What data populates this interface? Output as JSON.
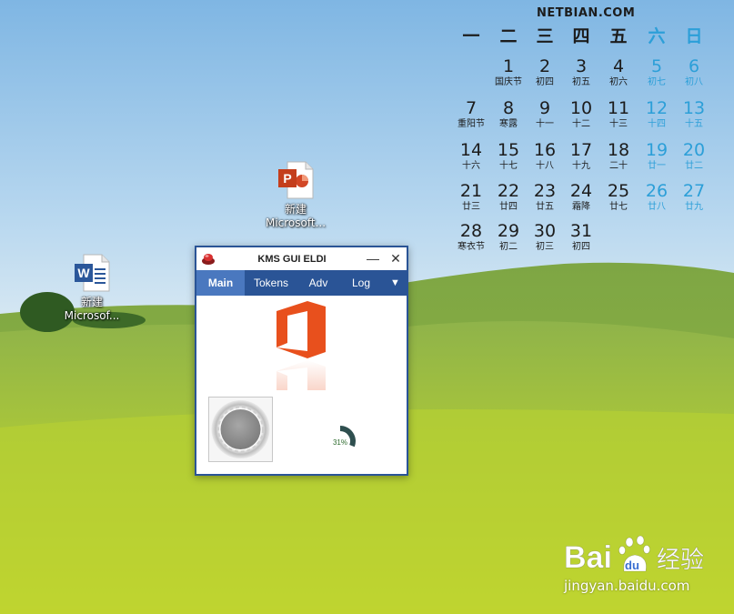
{
  "colors": {
    "window_accent": "#2a5496",
    "active_tab": "#4a78bf",
    "weekend": "#2c9fd8",
    "office_orange": "#e8501d",
    "progress_arc": "#2f4f4f"
  },
  "calendar": {
    "site": "NETBIAN.COM",
    "weekdays": [
      "一",
      "二",
      "三",
      "四",
      "五",
      "六",
      "日"
    ],
    "rows": [
      [
        null,
        null,
        null,
        null,
        null,
        null,
        null
      ],
      [
        null,
        {
          "d": "1",
          "s": "国庆节"
        },
        {
          "d": "2",
          "s": "初四"
        },
        {
          "d": "3",
          "s": "初五"
        },
        {
          "d": "4",
          "s": "初六"
        },
        {
          "d": "5",
          "s": "初七"
        },
        {
          "d": "6",
          "s": "初八"
        }
      ],
      [
        {
          "d": "7",
          "s": "重阳节"
        },
        {
          "d": "8",
          "s": "寒露"
        },
        {
          "d": "9",
          "s": "十一"
        },
        {
          "d": "10",
          "s": "十二"
        },
        {
          "d": "11",
          "s": "十三"
        },
        {
          "d": "12",
          "s": "十四"
        },
        {
          "d": "13",
          "s": "十五"
        }
      ],
      [
        {
          "d": "14",
          "s": "十六"
        },
        {
          "d": "15",
          "s": "十七"
        },
        {
          "d": "16",
          "s": "十八"
        },
        {
          "d": "17",
          "s": "十九"
        },
        {
          "d": "18",
          "s": "二十"
        },
        {
          "d": "19",
          "s": "廿一"
        },
        {
          "d": "20",
          "s": "廿二"
        }
      ],
      [
        {
          "d": "21",
          "s": "廿三"
        },
        {
          "d": "22",
          "s": "廿四"
        },
        {
          "d": "23",
          "s": "廿五"
        },
        {
          "d": "24",
          "s": "霜降"
        },
        {
          "d": "25",
          "s": "廿七"
        },
        {
          "d": "26",
          "s": "廿八"
        },
        {
          "d": "27",
          "s": "廿九"
        }
      ],
      [
        {
          "d": "28",
          "s": "寒衣节"
        },
        {
          "d": "29",
          "s": "初二"
        },
        {
          "d": "30",
          "s": "初三"
        },
        {
          "d": "31",
          "s": "初四"
        },
        null,
        null,
        null
      ]
    ]
  },
  "desktop": {
    "ppt_icon": {
      "line1": "新建",
      "line2": "Microsoft...",
      "icon": "powerpoint-icon"
    },
    "word_icon": {
      "line1": "新建",
      "line2": "Microsof...",
      "icon": "word-icon"
    }
  },
  "window": {
    "title": "KMS GUI ELDI",
    "minimize": "—",
    "close": "✕",
    "tabs": {
      "main": "Main",
      "tokens": "Tokens",
      "adv": "Adv",
      "log": "Log",
      "dropdown": "▼"
    },
    "progress": {
      "value": 31,
      "label": "31%"
    }
  },
  "watermark": {
    "brand": "Bai",
    "brand2": "经验",
    "url": "jingyan.baidu.com"
  }
}
